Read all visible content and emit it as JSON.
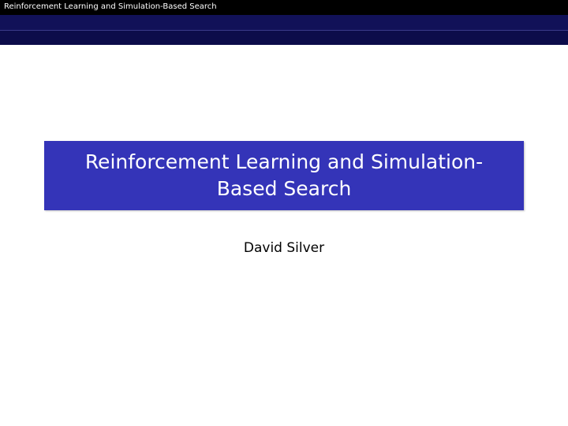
{
  "headline": {
    "text": "Reinforcement Learning and Simulation-Based Search"
  },
  "title": {
    "text": "Reinforcement Learning and Simulation-Based Search"
  },
  "author": {
    "name": "David Silver"
  },
  "colors": {
    "headline_bg": "#000000",
    "nav_band": "#0c0c4a",
    "title_box": "#3434b8",
    "title_text": "#ffffff"
  }
}
